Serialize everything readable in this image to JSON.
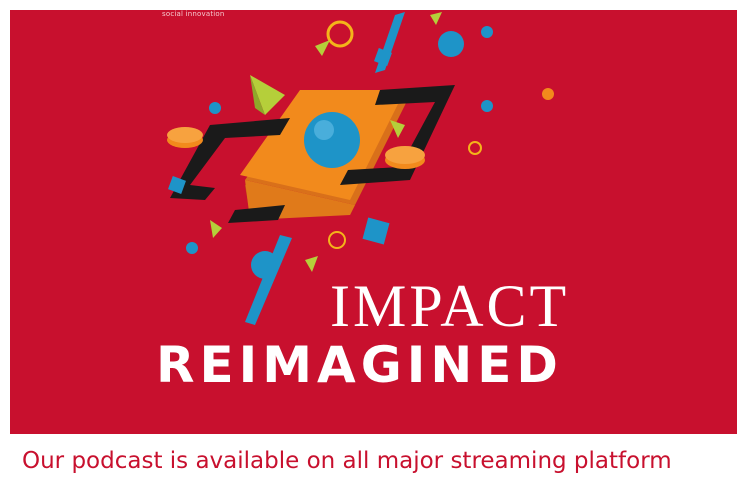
{
  "banner": {
    "tiny_caption": "social innovation",
    "title_line1": "IMPACT",
    "title_line2": "REIMAGINED",
    "background_color": "#c8102e"
  },
  "caption": "Our podcast is available on all major streaming platform",
  "colors": {
    "caption_text": "#c8102e",
    "orange": "#f28a1c",
    "blue": "#1e94c8",
    "lime": "#b5cf3a",
    "black": "#1a1a1a"
  }
}
